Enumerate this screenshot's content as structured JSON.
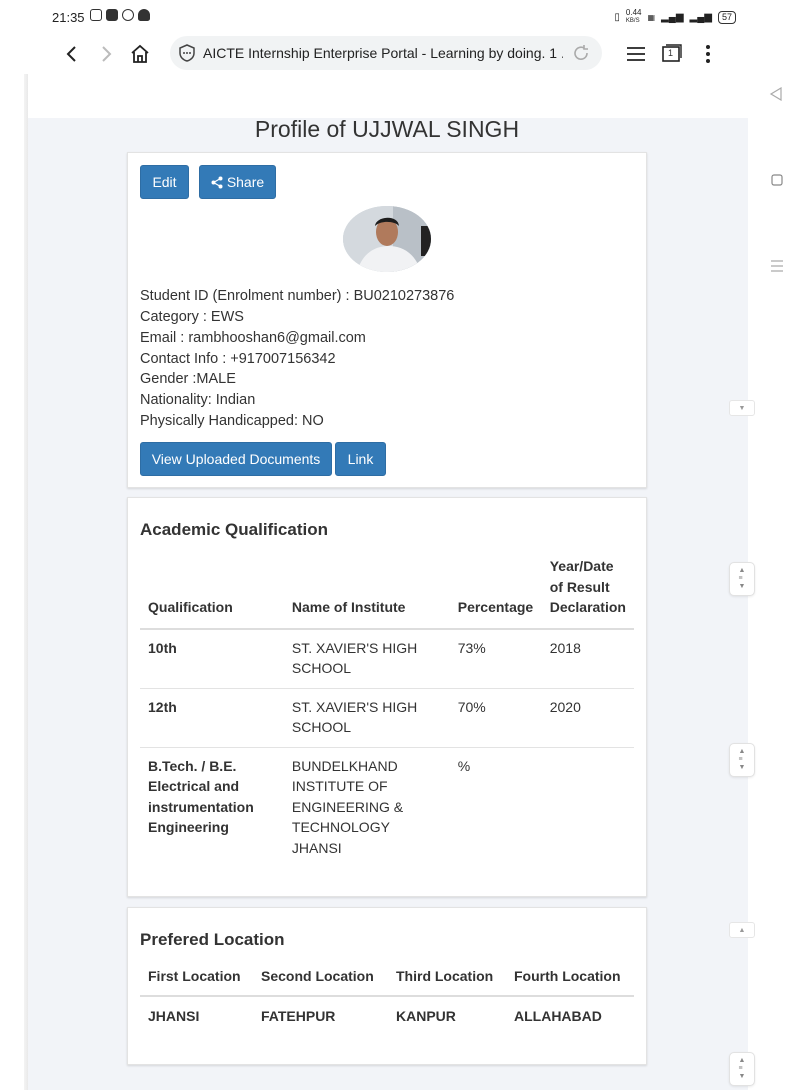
{
  "status_bar": {
    "time": "21:35",
    "net_speed_value": "0.44",
    "net_speed_unit": "KB/S",
    "battery": "57"
  },
  "browser": {
    "url_text": "AICTE Internship Enterprise Portal - Learning by doing. 1 ...",
    "tab_count": "1"
  },
  "profile": {
    "title": "Profile of UJJWAL SINGH",
    "edit_label": "Edit",
    "share_label": "Share",
    "student_id": "Student ID (Enrolment number) : BU0210273876",
    "category": "Category : EWS",
    "email": "Email : rambhooshan6@gmail.com",
    "contact": "Contact Info : +917007156342",
    "gender": "Gender :MALE",
    "nationality": "Nationality: Indian",
    "handicapped": "Physically Handicapped: NO",
    "view_docs_label": "View Uploaded Documents",
    "link_label": "Link"
  },
  "academic": {
    "heading": "Academic Qualification",
    "headers": [
      "Qualification",
      "Name of Institute",
      "Percentage",
      "Year/Date of Result Declaration"
    ],
    "rows": [
      {
        "qualification": "10th",
        "institute": "ST. XAVIER'S HIGH SCHOOL",
        "percentage": "73%",
        "year": "2018"
      },
      {
        "qualification": "12th",
        "institute": "ST. XAVIER'S HIGH SCHOOL",
        "percentage": "70%",
        "year": "2020"
      },
      {
        "qualification": "B.Tech. / B.E. Electrical and instrumentation Engineering",
        "institute": "BUNDELKHAND INSTITUTE OF ENGINEERING & TECHNOLOGY JHANSI",
        "percentage": "%",
        "year": ""
      }
    ]
  },
  "location": {
    "heading": "Prefered Location",
    "headers": [
      "First Location",
      "Second Location",
      "Third Location",
      "Fourth Location"
    ],
    "values": [
      "JHANSI",
      "FATEHPUR",
      "KANPUR",
      "ALLAHABAD"
    ]
  },
  "colors": {
    "primary_button": "#337ab7",
    "page_bg": "#f2f4f8"
  }
}
